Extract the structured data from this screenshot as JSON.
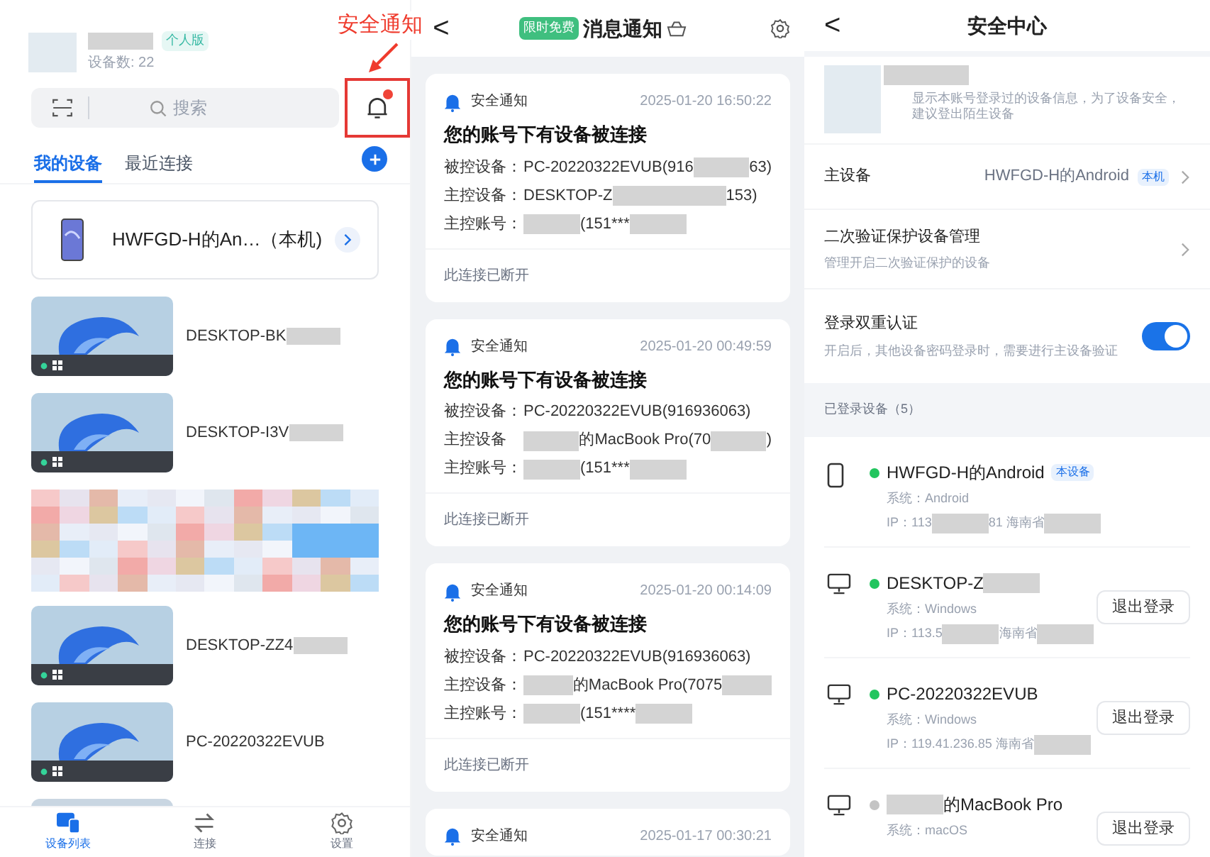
{
  "annotation": {
    "text": "安全通知"
  },
  "device_list_screen": {
    "account": {
      "badge": "个人版",
      "device_count": "设备数: 22"
    },
    "search": {
      "placeholder": "搜索"
    },
    "notification_bell": {
      "unread": true,
      "highlighted": true
    },
    "tabs": [
      {
        "label": "我的设备",
        "selected": true
      },
      {
        "label": "最近连接",
        "selected": false
      }
    ],
    "this_device": {
      "name": "HWFGD-H的An…（本机)"
    },
    "devices": [
      {
        "kind": "pc",
        "name": "DESKTOP-BK",
        "name_redacted": true
      },
      {
        "kind": "pc",
        "name": "DESKTOP-I3V",
        "name_redacted": true
      },
      {
        "kind": "redacted"
      },
      {
        "kind": "pc",
        "name": "DESKTOP-ZZ4",
        "name_redacted": true
      },
      {
        "kind": "pc",
        "name": "PC-20220322EVUB",
        "name_redacted": false
      },
      {
        "kind": "cut"
      }
    ],
    "bottom_nav": [
      {
        "label": "设备列表",
        "kind": "devices",
        "selected": true
      },
      {
        "label": "连接",
        "kind": "connect",
        "selected": false
      },
      {
        "label": "设置",
        "kind": "settings",
        "selected": false
      }
    ]
  },
  "notifications_screen": {
    "back": "<",
    "badge": "限时免费",
    "title": "消息通知",
    "cards": [
      {
        "category": "安全通知",
        "time": "2025-01-20 16:50:22",
        "title": "您的账号下有设备被连接",
        "fields": [
          {
            "label": "被控设备：",
            "value": [
              {
                "kind": "text",
                "text": "PC-20220322EVUB(916"
              },
              {
                "kind": "blur"
              },
              {
                "kind": "text",
                "text": "63)"
              }
            ]
          },
          {
            "label": "主控设备：",
            "value": [
              {
                "kind": "text",
                "text": "DESKTOP-Z"
              },
              {
                "kind": "blur"
              },
              {
                "kind": "blur"
              },
              {
                "kind": "text",
                "text": "153)"
              }
            ]
          },
          {
            "label": "主控账号：",
            "value": [
              {
                "kind": "blur"
              },
              {
                "kind": "text",
                "text": "(151***"
              },
              {
                "kind": "blur"
              }
            ]
          }
        ],
        "footer": "此连接已断开"
      },
      {
        "category": "安全通知",
        "time": "2025-01-20 00:49:59",
        "title": "您的账号下有设备被连接",
        "fields": [
          {
            "label": "被控设备：",
            "value": [
              {
                "kind": "text",
                "text": "PC-20220322EVUB(916936063)"
              }
            ]
          },
          {
            "label": "主控设备",
            "value": [
              {
                "kind": "blur"
              },
              {
                "kind": "text",
                "text": "的MacBook Pro(70"
              },
              {
                "kind": "blur"
              },
              {
                "kind": "text",
                "text": ")"
              }
            ]
          },
          {
            "label": "主控账号：",
            "value": [
              {
                "kind": "blur"
              },
              {
                "kind": "text",
                "text": "(151***"
              },
              {
                "kind": "blur"
              }
            ]
          }
        ],
        "footer": "此连接已断开"
      },
      {
        "category": "安全通知",
        "time": "2025-01-20 00:14:09",
        "title": "您的账号下有设备被连接",
        "fields": [
          {
            "label": "被控设备：",
            "value": [
              {
                "kind": "text",
                "text": "PC-20220322EVUB(916936063)"
              }
            ]
          },
          {
            "label": "主控设备：",
            "value": [
              {
                "kind": "blur"
              },
              {
                "kind": "text",
                "text": "的MacBook Pro(7075"
              },
              {
                "kind": "blur"
              }
            ]
          },
          {
            "label": "主控账号：",
            "value": [
              {
                "kind": "blur"
              },
              {
                "kind": "text",
                "text": "(151****"
              },
              {
                "kind": "blur"
              }
            ]
          }
        ],
        "footer": "此连接已断开"
      },
      {
        "category": "安全通知",
        "time": "2025-01-17 00:30:21"
      }
    ]
  },
  "security_center": {
    "back": "<",
    "title": "安全中心",
    "description": "显示本账号登录过的设备信息，为了设备安全，建议登出陌生设备",
    "main_device": {
      "label": "主设备",
      "value": "HWFGD-H的Android",
      "badge": "本机"
    },
    "verification": {
      "label": "二次验证保护设备管理",
      "subtitle": "管理开启二次验证保护的设备"
    },
    "dual_auth": {
      "label": "登录双重认证",
      "subtitle": "开启后，其他设备密码登录时，需要进行主设备验证",
      "on": true
    },
    "section": "已登录设备（5）",
    "devices": [
      {
        "kind": "phone",
        "color": "#22c55e",
        "name": [
          {
            "kind": "text",
            "text": "HWFGD-H的Android"
          }
        ],
        "badge": "本设备",
        "system": "系统：Android",
        "ip": [
          {
            "kind": "text",
            "text": "IP：113"
          },
          {
            "kind": "blur"
          },
          {
            "kind": "text",
            "text": "81 海南省"
          },
          {
            "kind": "blur"
          }
        ]
      },
      {
        "kind": "monitor",
        "color": "#22c55e",
        "name": [
          {
            "kind": "text",
            "text": "DESKTOP-Z"
          },
          {
            "kind": "blur"
          }
        ],
        "system": "系统：Windows",
        "ip": [
          {
            "kind": "text",
            "text": "IP：113.5"
          },
          {
            "kind": "blur"
          },
          {
            "kind": "text",
            "text": "海南省"
          },
          {
            "kind": "blur"
          }
        ],
        "button": "退出登录"
      },
      {
        "kind": "monitor",
        "color": "#22c55e",
        "name": [
          {
            "kind": "text",
            "text": "PC-20220322EVUB"
          }
        ],
        "system": "系统：Windows",
        "ip": [
          {
            "kind": "text",
            "text": "IP：119.41.236.85 海南省"
          },
          {
            "kind": "blur"
          }
        ],
        "button": "退出登录"
      },
      {
        "kind": "monitor",
        "color": "#c4c4c4",
        "name": [
          {
            "kind": "blur"
          },
          {
            "kind": "text",
            "text": "的MacBook Pro"
          }
        ],
        "system": "系统：macOS",
        "button": "退出登录"
      }
    ]
  }
}
